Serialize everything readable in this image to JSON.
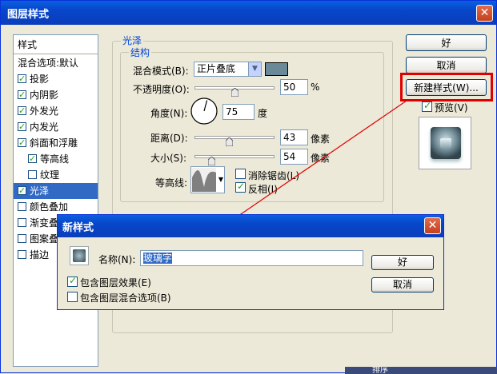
{
  "window": {
    "title": "图层样式"
  },
  "styles_list": {
    "header": "样式",
    "items": [
      {
        "label": "混合选项:默认",
        "checkbox": false,
        "checked": false,
        "indent": false,
        "selected": false
      },
      {
        "label": "投影",
        "checkbox": true,
        "checked": true,
        "indent": false,
        "selected": false
      },
      {
        "label": "内阴影",
        "checkbox": true,
        "checked": true,
        "indent": false,
        "selected": false
      },
      {
        "label": "外发光",
        "checkbox": true,
        "checked": true,
        "indent": false,
        "selected": false
      },
      {
        "label": "内发光",
        "checkbox": true,
        "checked": true,
        "indent": false,
        "selected": false
      },
      {
        "label": "斜面和浮雕",
        "checkbox": true,
        "checked": true,
        "indent": false,
        "selected": false
      },
      {
        "label": "等高线",
        "checkbox": true,
        "checked": true,
        "indent": true,
        "selected": false
      },
      {
        "label": "纹理",
        "checkbox": true,
        "checked": false,
        "indent": true,
        "selected": false
      },
      {
        "label": "光泽",
        "checkbox": true,
        "checked": true,
        "indent": false,
        "selected": true
      },
      {
        "label": "颜色叠加",
        "checkbox": true,
        "checked": false,
        "indent": false,
        "selected": false
      },
      {
        "label": "渐变叠",
        "checkbox": true,
        "checked": false,
        "indent": false,
        "selected": false
      },
      {
        "label": "图案叠",
        "checkbox": true,
        "checked": false,
        "indent": false,
        "selected": false
      },
      {
        "label": "描边",
        "checkbox": true,
        "checked": false,
        "indent": false,
        "selected": false
      }
    ]
  },
  "satin": {
    "group_title": "光泽",
    "structure_title": "结构",
    "blend_mode_label": "混合模式(B):",
    "blend_mode_value": "正片叠底",
    "blend_color": "#6a8a9a",
    "opacity_label": "不透明度(O):",
    "opacity_value": "50",
    "opacity_fraction": 0.5,
    "opacity_unit": "%",
    "angle_label": "角度(N):",
    "angle_value": "75",
    "angle_unit": "度",
    "distance_label": "距离(D):",
    "distance_value": "43",
    "distance_fraction": 0.43,
    "distance_unit": "像素",
    "size_label": "大小(S):",
    "size_value": "54",
    "size_fraction": 0.21,
    "size_unit": "像素",
    "contour_label": "等高线:",
    "antialias_label": "消除锯齿(L)",
    "antialias_checked": false,
    "invert_label": "反相(I)",
    "invert_checked": true
  },
  "side_buttons": {
    "ok": "好",
    "cancel": "取消",
    "new_style": "新建样式(W)...",
    "preview_label": "预览(V)",
    "preview_checked": true
  },
  "new_style_dialog": {
    "title": "新样式",
    "name_label": "名称(N):",
    "name_value": "玻璃字",
    "ok": "好",
    "cancel": "取消",
    "include_effects_label": "包含图层效果(E)",
    "include_effects_checked": true,
    "include_blending_label": "包含图层混合选项(B)",
    "include_blending_checked": false
  },
  "colors": {
    "title_bar": "#0a49d0",
    "selection": "#316ac5",
    "highlight_box": "#e00000",
    "arrow": "#e00000"
  },
  "background_snippets": {
    "bottom_right": "排序"
  }
}
